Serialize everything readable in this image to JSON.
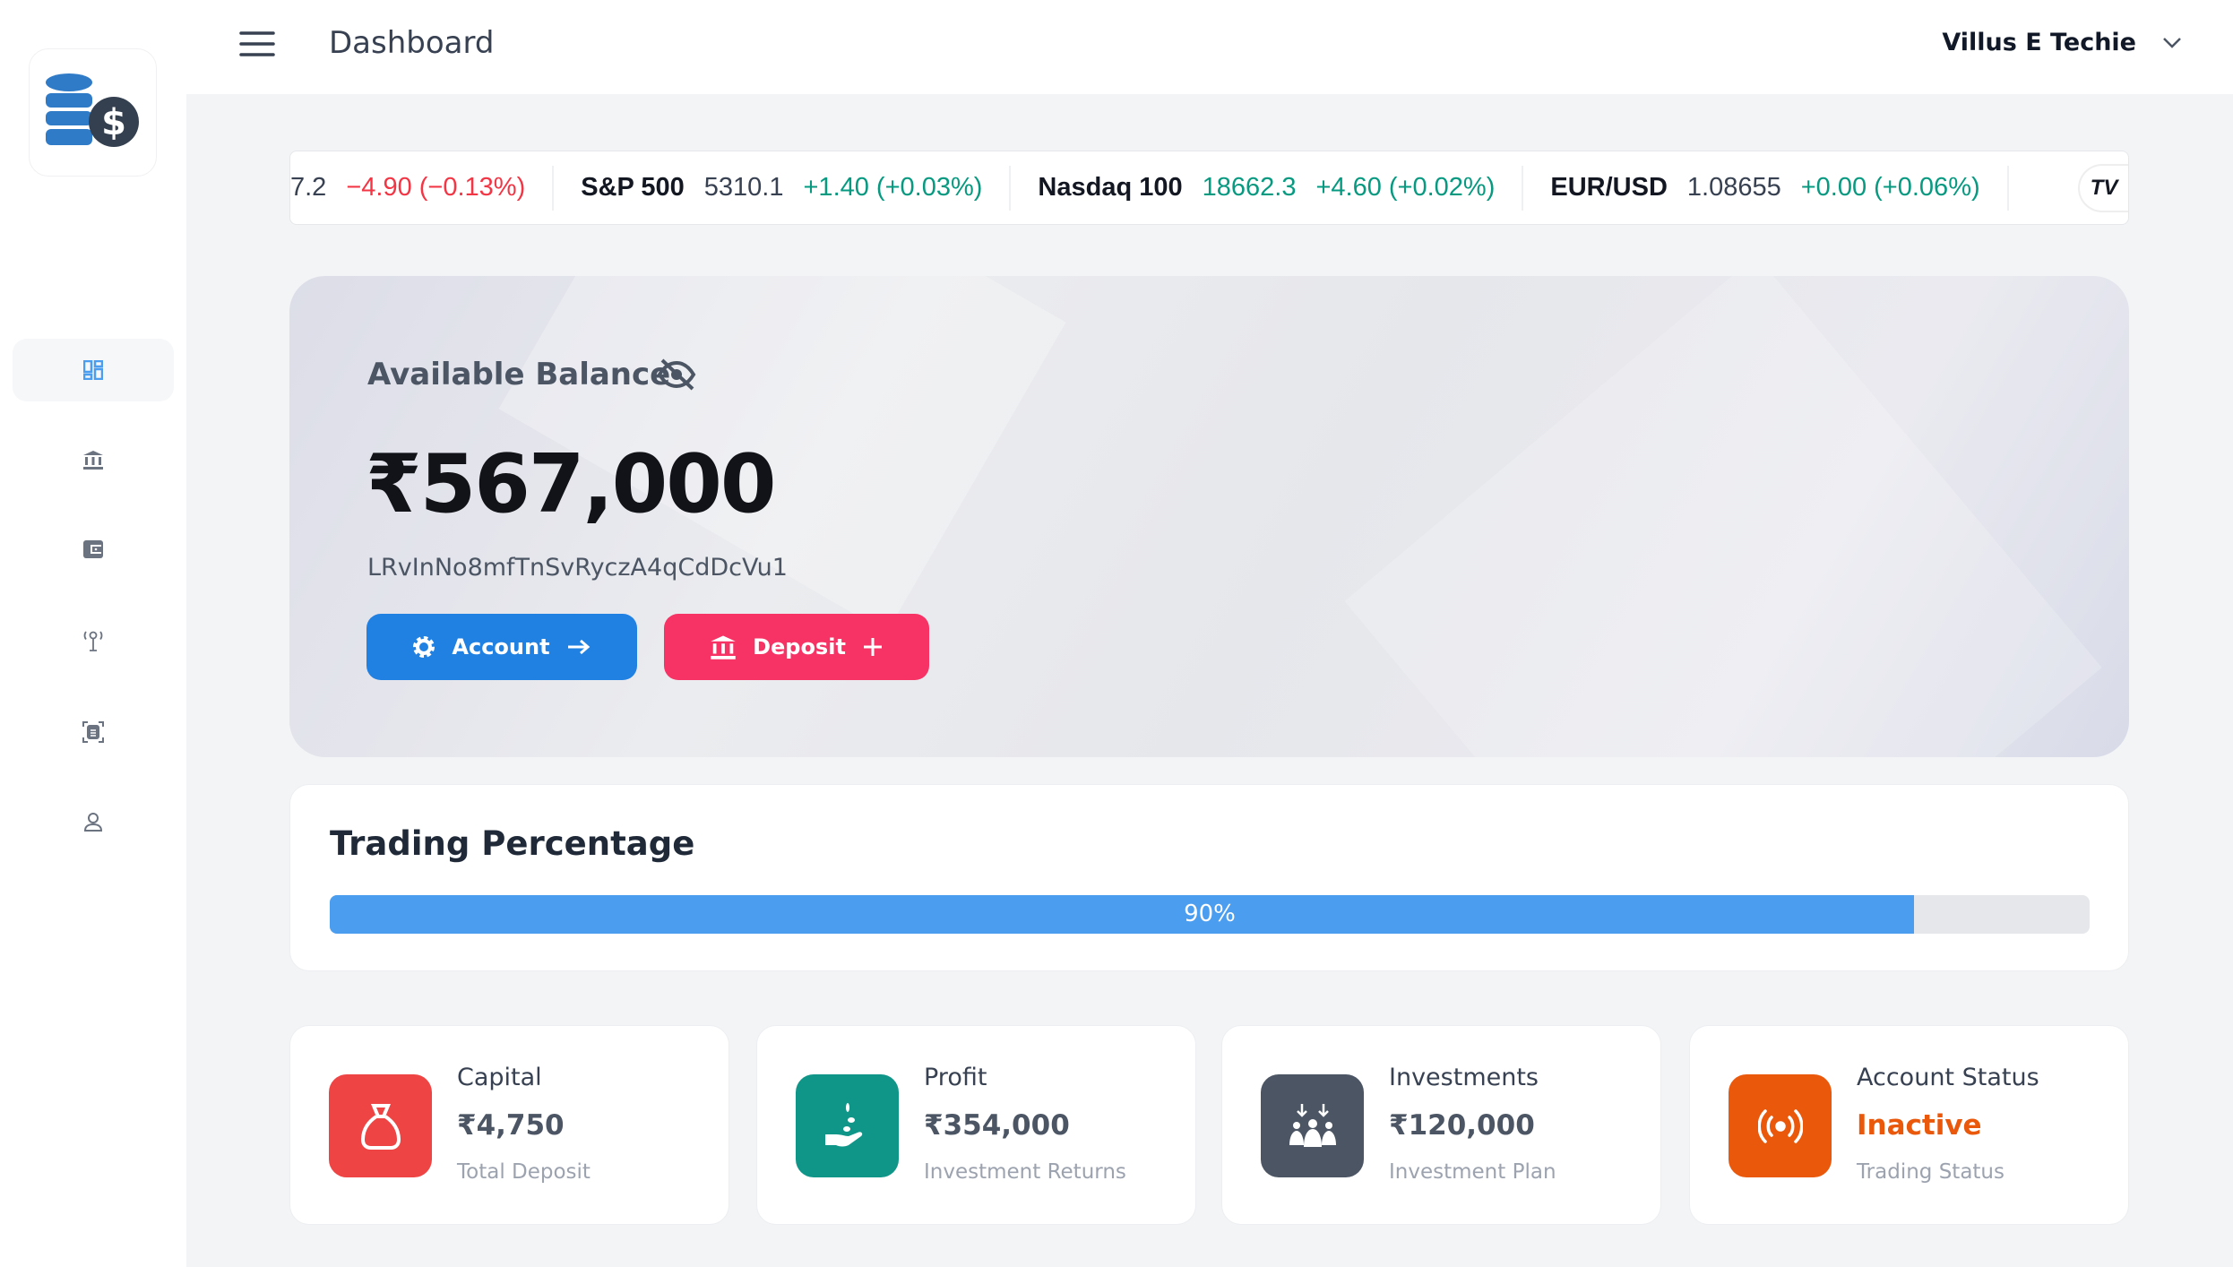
{
  "header": {
    "title": "Dashboard",
    "user_name": "Villus E Techie"
  },
  "sidebar": {
    "items": [
      {
        "icon": "dashboard-icon",
        "active": true
      },
      {
        "icon": "bank-icon"
      },
      {
        "icon": "wallet-icon"
      },
      {
        "icon": "antenna-icon"
      },
      {
        "icon": "scan-document-icon"
      },
      {
        "icon": "user-icon"
      }
    ]
  },
  "ticker": {
    "items": [
      {
        "symbol": "",
        "price": "7.2",
        "change": "−4.90 (−0.13%)",
        "direction": "down"
      },
      {
        "symbol": "S&P 500",
        "price": "5310.1",
        "change": "+1.40 (+0.03%)",
        "direction": "up"
      },
      {
        "symbol": "Nasdaq 100",
        "price": "18662.3",
        "change": "+4.60 (+0.02%)",
        "direction": "up"
      },
      {
        "symbol": "EUR/USD",
        "price": "1.08655",
        "change": "+0.00 (+0.06%)",
        "direction": "up"
      }
    ],
    "brand": "TV"
  },
  "balance": {
    "label": "Available Balance",
    "amount": "₹567,000",
    "address": "LRvInNo8mfTnSvRyczA4qCdDcVu1",
    "account_button": "Account",
    "deposit_button": "Deposit"
  },
  "trading": {
    "title": "Trading Percentage",
    "percent": 90,
    "percent_label": "90%"
  },
  "stats": [
    {
      "title": "Capital",
      "value": "₹4,750",
      "subtitle": "Total Deposit",
      "color": "#ef4444",
      "icon": "money-bag-icon"
    },
    {
      "title": "Profit",
      "value": "₹354,000",
      "subtitle": "Investment Returns",
      "color": "#0f9688",
      "icon": "hand-coins-icon"
    },
    {
      "title": "Investments",
      "value": "₹120,000",
      "subtitle": "Investment Plan",
      "color": "#4b5563",
      "icon": "group-icon"
    },
    {
      "title": "Account Status",
      "value": "Inactive",
      "subtitle": "Trading Status",
      "color": "#ea580c",
      "icon": "broadcast-icon"
    }
  ],
  "colors": {
    "accent": "#2181e3",
    "deposit": "#f73366",
    "progress": "#4b9df0",
    "down": "#f23645",
    "up": "#089981"
  }
}
